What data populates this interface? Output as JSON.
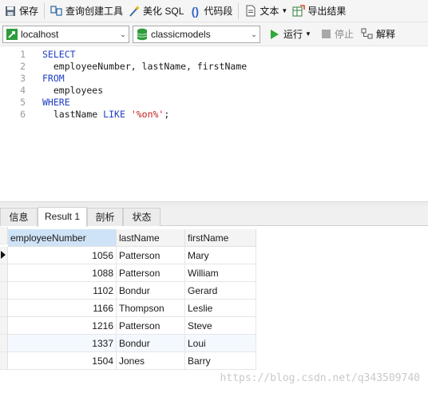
{
  "toolbar": {
    "save": "保存",
    "query_builder": "查询创建工具",
    "beautify_sql": "美化 SQL",
    "code_snippet": "代码段",
    "text": "文本",
    "export_results": "导出结果"
  },
  "connection_bar": {
    "connection": "localhost",
    "database": "classicmodels",
    "run": "运行",
    "stop": "停止",
    "explain": "解释"
  },
  "editor": {
    "lines": [
      {
        "no": "1",
        "parts": [
          {
            "t": "SELECT",
            "k": "kw"
          }
        ]
      },
      {
        "no": "2",
        "parts": [
          {
            "t": "  employeeNumber, lastName, firstName",
            "k": ""
          }
        ]
      },
      {
        "no": "3",
        "parts": [
          {
            "t": "FROM",
            "k": "kw"
          }
        ]
      },
      {
        "no": "4",
        "parts": [
          {
            "t": "  employees",
            "k": ""
          }
        ]
      },
      {
        "no": "5",
        "parts": [
          {
            "t": "WHERE",
            "k": "kw"
          }
        ]
      },
      {
        "no": "6",
        "parts": [
          {
            "t": "  lastName ",
            "k": ""
          },
          {
            "t": "LIKE",
            "k": "kw"
          },
          {
            "t": " ",
            "k": ""
          },
          {
            "t": "'%on%'",
            "k": "str"
          },
          {
            "t": ";",
            "k": ""
          }
        ]
      }
    ]
  },
  "result_tabs": [
    "信息",
    "Result 1",
    "剖析",
    "状态"
  ],
  "result_grid": {
    "columns": [
      "employeeNumber",
      "lastName",
      "firstName"
    ],
    "rows": [
      [
        "1056",
        "Patterson",
        "Mary"
      ],
      [
        "1088",
        "Patterson",
        "William"
      ],
      [
        "1102",
        "Bondur",
        "Gerard"
      ],
      [
        "1166",
        "Thompson",
        "Leslie"
      ],
      [
        "1216",
        "Patterson",
        "Steve"
      ],
      [
        "1337",
        "Bondur",
        "Loui"
      ],
      [
        "1504",
        "Jones",
        "Barry"
      ]
    ]
  },
  "watermark": "https://blog.csdn.net/q343509740",
  "colors": {
    "keyword": "#1f3ec4",
    "string": "#c31a1a",
    "header_selected": "#cfe3f7",
    "run_green": "#2eaa3a"
  }
}
